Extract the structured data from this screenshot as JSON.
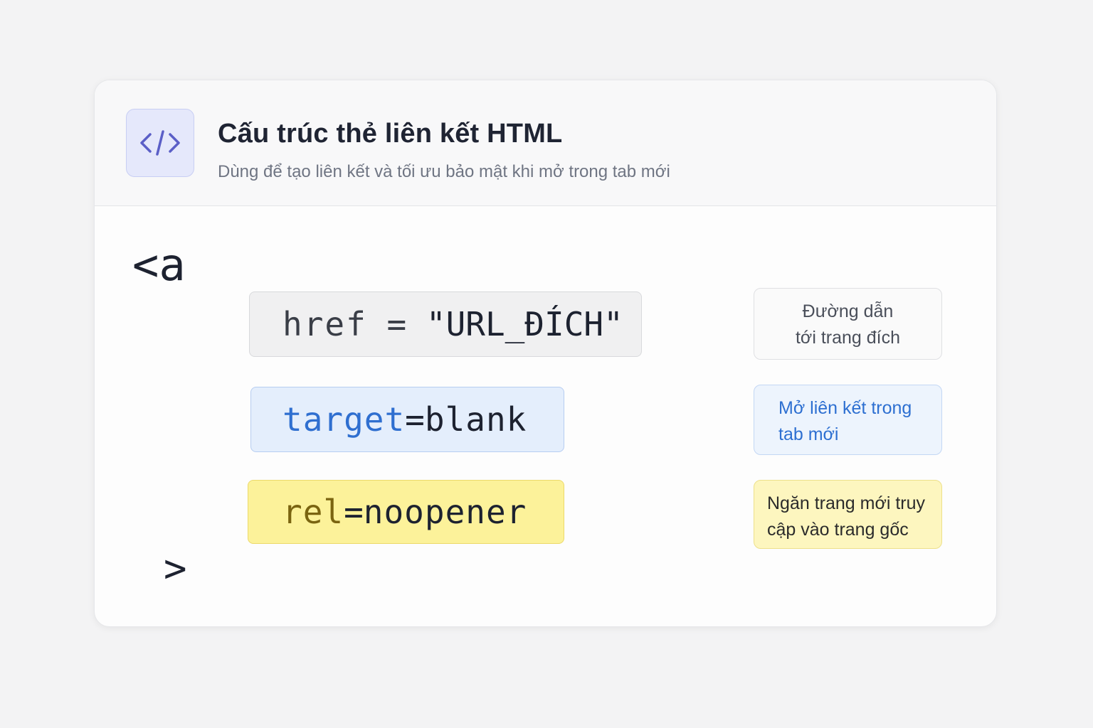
{
  "header": {
    "icon": "code-brackets-icon",
    "title": "Cấu trúc thẻ liên kết HTML",
    "subtitle": "Dùng để tạo liên kết và tối ưu bảo mật khi mở trong tab mới"
  },
  "code": {
    "open": "<a",
    "close": ">",
    "attributes": [
      {
        "name": "href",
        "separator": " = ",
        "value": "\"URL_ĐÍCH\"",
        "note_lines": [
          "Đường dẫn",
          "tới trang đích"
        ]
      },
      {
        "name": "target",
        "separator": "=",
        "value": "blank",
        "note_lines": [
          "Mở liên kết trong",
          "tab mới"
        ]
      },
      {
        "name": "rel",
        "separator": "=",
        "value": "noopener",
        "note_lines": [
          "Ngăn trang mới truy",
          "cập vào trang gốc"
        ]
      }
    ]
  },
  "colors": {
    "neutral": "#9aa0a8",
    "blue": "#2f78e0",
    "yellow": "#f2cc2a",
    "icon_accent": "#5b5fc7"
  }
}
